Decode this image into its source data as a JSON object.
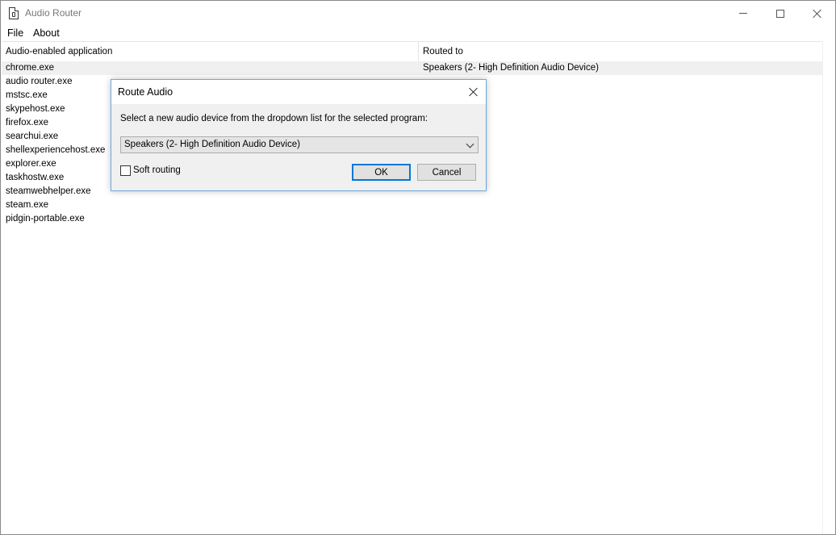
{
  "window": {
    "title": "Audio Router",
    "icon": "document-icon",
    "controls": [
      "minimize-icon",
      "maximize-icon",
      "close-icon"
    ]
  },
  "menu": {
    "file": "File",
    "about": "About"
  },
  "list": {
    "columns": [
      "Audio-enabled application",
      "Routed to"
    ],
    "rows": [
      {
        "app": "chrome.exe",
        "routed": "Speakers (2- High Definition Audio Device)",
        "selected": true
      },
      {
        "app": "audio router.exe",
        "routed": ""
      },
      {
        "app": "mstsc.exe",
        "routed": ""
      },
      {
        "app": "skypehost.exe",
        "routed": ""
      },
      {
        "app": "firefox.exe",
        "routed": ""
      },
      {
        "app": "searchui.exe",
        "routed": ""
      },
      {
        "app": "shellexperiencehost.exe",
        "routed": ""
      },
      {
        "app": "explorer.exe",
        "routed": ""
      },
      {
        "app": "taskhostw.exe",
        "routed": ""
      },
      {
        "app": "steamwebhelper.exe",
        "routed": ""
      },
      {
        "app": "steam.exe",
        "routed": ""
      },
      {
        "app": "pidgin-portable.exe",
        "routed": ""
      }
    ]
  },
  "dialog": {
    "title": "Route Audio",
    "prompt": "Select a new audio device from the dropdown list for the selected program:",
    "device_selected": "Speakers (2- High Definition Audio Device)",
    "soft_routing_label": "Soft routing",
    "soft_routing_checked": false,
    "ok_label": "OK",
    "cancel_label": "Cancel"
  },
  "colors": {
    "accent": "#0078d7",
    "selected_row": "#f0f0f0",
    "dialog_bg": "#f0f0f0"
  }
}
